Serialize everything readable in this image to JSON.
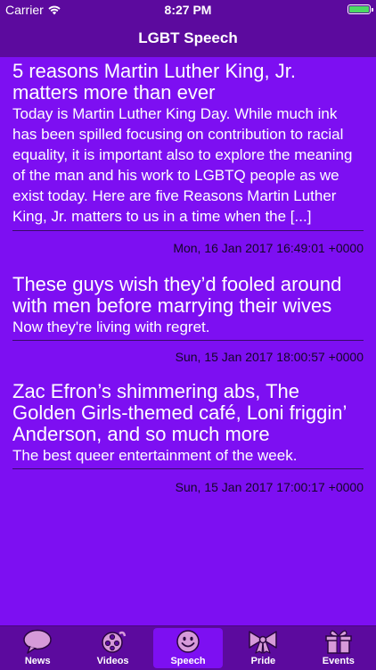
{
  "status_bar": {
    "carrier": "Carrier",
    "time": "8:27 PM"
  },
  "nav": {
    "title": "LGBT Speech"
  },
  "articles": [
    {
      "headline": "5 reasons Martin Luther King, Jr. matters more than ever",
      "summary": "Today is Martin Luther King Day. While much ink has been spilled focusing on contribution to racial equality, it is important also to explore the meaning of the man and his work to LGBTQ people as we exist today. Here are five Reasons Martin Luther King, Jr. matters to us in a time when the [...]",
      "date": "Mon, 16 Jan 2017 16:49:01 +0000"
    },
    {
      "headline": "These guys wish they’d fooled around with men before marrying their wives",
      "summary": "Now they're living with regret.",
      "date": "Sun, 15 Jan 2017 18:00:57 +0000"
    },
    {
      "headline": "Zac Efron’s shimmering abs, The Golden Girls-themed café, Loni friggin’ Anderson, and so much more",
      "summary": "The best queer entertainment of the week.",
      "date": "Sun, 15 Jan 2017 17:00:17 +0000"
    }
  ],
  "tabs": [
    {
      "label": "News",
      "icon": "speech-bubble-icon",
      "active": false
    },
    {
      "label": "Videos",
      "icon": "film-reel-icon",
      "active": false
    },
    {
      "label": "Speech",
      "icon": "smiley-face-icon",
      "active": true
    },
    {
      "label": "Pride",
      "icon": "bow-icon",
      "active": false
    },
    {
      "label": "Events",
      "icon": "gift-icon",
      "active": false
    }
  ],
  "colors": {
    "background": "#7d0ff2",
    "bars": "#5c0a9e",
    "icon_fill": "#d69ad9",
    "date_text": "#140628"
  }
}
